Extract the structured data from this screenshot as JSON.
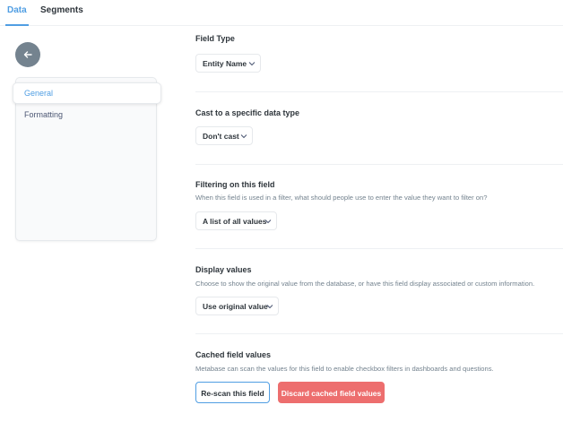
{
  "tabs": {
    "data": "Data",
    "segments": "Segments"
  },
  "sidebar": {
    "items": [
      {
        "label": "General"
      },
      {
        "label": "Formatting"
      }
    ]
  },
  "field_type": {
    "title": "Field Type",
    "value": "Entity Name"
  },
  "cast": {
    "title": "Cast to a specific data type",
    "value": "Don't cast"
  },
  "filtering": {
    "title": "Filtering on this field",
    "description": "When this field is used in a filter, what should people use to enter the value they want to filter on?",
    "value": "A list of all values"
  },
  "display_values": {
    "title": "Display values",
    "description": "Choose to show the original value from the database, or have this field display associated or custom information.",
    "value": "Use original value"
  },
  "cached": {
    "title": "Cached field values",
    "description": "Metabase can scan the values for this field to enable checkbox filters in dashboards and questions.",
    "rescan_label": "Re-scan this field",
    "discard_label": "Discard cached field values"
  },
  "colors": {
    "accent": "#509ee3",
    "danger": "#ed6e6e",
    "back_button": "#74838f"
  },
  "icons": {
    "back": "arrow-left-icon",
    "dropdown": "chevron-down-icon"
  }
}
